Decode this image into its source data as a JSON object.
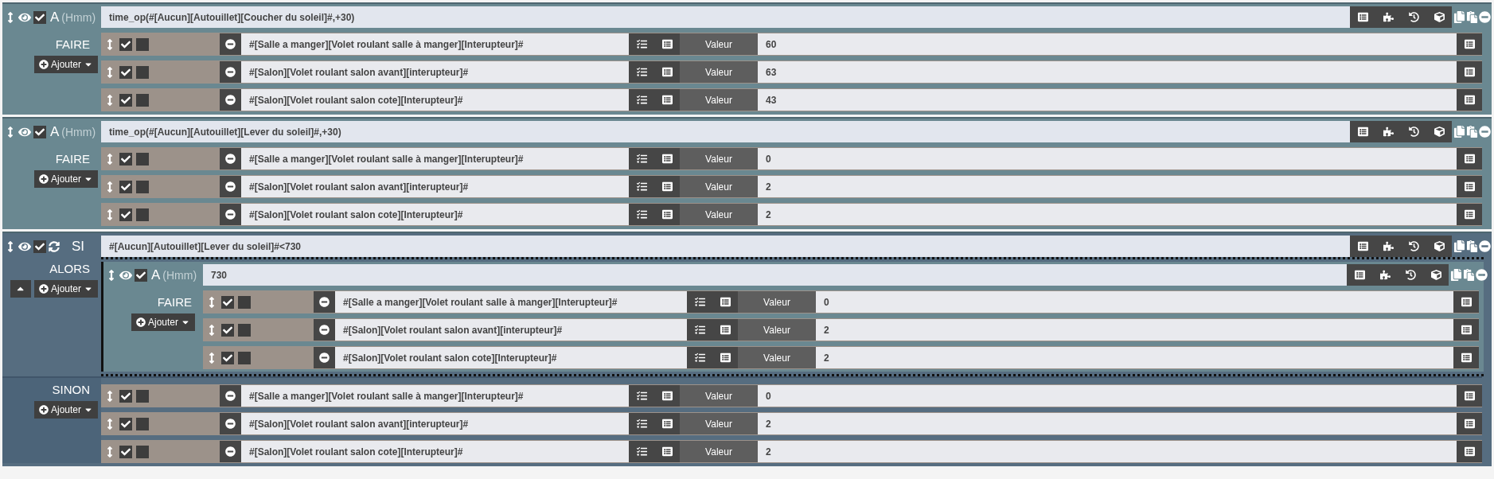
{
  "blocks": [
    {
      "kind": "action",
      "label": "A",
      "unit": "(Hmm)",
      "enabled": true,
      "expression": "time_op(#[Aucun][Autouillet][Coucher du soleil]#,+30)",
      "section_label": "FAIRE",
      "add_button": "Ajouter",
      "actions": [
        {
          "enabled": true,
          "option_checked": false,
          "command": "#[Salle a manger][Volet roulant salle à manger][Interupteur]#",
          "option_label": "Valeur",
          "value": "60"
        },
        {
          "enabled": true,
          "option_checked": false,
          "command": "#[Salon][Volet roulant salon avant][interupteur]#",
          "option_label": "Valeur",
          "value": "63"
        },
        {
          "enabled": true,
          "option_checked": false,
          "command": "#[Salon][Volet roulant salon cote][Interupteur]#",
          "option_label": "Valeur",
          "value": "43"
        }
      ]
    },
    {
      "kind": "action",
      "label": "A",
      "unit": "(Hmm)",
      "enabled": true,
      "expression": "time_op(#[Aucun][Autouillet][Lever du soleil]#,+30)",
      "section_label": "FAIRE",
      "add_button": "Ajouter",
      "actions": [
        {
          "enabled": true,
          "option_checked": false,
          "command": "#[Salle a manger][Volet roulant salle à manger][Interupteur]#",
          "option_label": "Valeur",
          "value": "0"
        },
        {
          "enabled": true,
          "option_checked": false,
          "command": "#[Salon][Volet roulant salon avant][interupteur]#",
          "option_label": "Valeur",
          "value": "2"
        },
        {
          "enabled": true,
          "option_checked": false,
          "command": "#[Salon][Volet roulant salon cote][Interupteur]#",
          "option_label": "Valeur",
          "value": "2"
        }
      ]
    },
    {
      "kind": "if",
      "label": "SI",
      "enabled": true,
      "expression": "#[Aucun][Autouillet][Lever du soleil]#<730",
      "then_label": "ALORS",
      "then_add": "Ajouter",
      "then": [
        {
          "kind": "action",
          "label": "A",
          "unit": "(Hmm)",
          "enabled": true,
          "expression": "730",
          "section_label": "FAIRE",
          "add_button": "Ajouter",
          "actions": [
            {
              "enabled": true,
              "option_checked": false,
              "command": "#[Salle a manger][Volet roulant salle à manger][Interupteur]#",
              "option_label": "Valeur",
              "value": "0"
            },
            {
              "enabled": true,
              "option_checked": false,
              "command": "#[Salon][Volet roulant salon avant][interupteur]#",
              "option_label": "Valeur",
              "value": "2"
            },
            {
              "enabled": true,
              "option_checked": false,
              "command": "#[Salon][Volet roulant salon cote][Interupteur]#",
              "option_label": "Valeur",
              "value": "2"
            }
          ]
        }
      ],
      "else_label": "SINON",
      "else_add": "Ajouter",
      "else": [
        {
          "enabled": true,
          "option_checked": false,
          "command": "#[Salle a manger][Volet roulant salle à manger][Interupteur]#",
          "option_label": "Valeur",
          "value": "0"
        },
        {
          "enabled": true,
          "option_checked": false,
          "command": "#[Salon][Volet roulant salon avant][interupteur]#",
          "option_label": "Valeur",
          "value": "2"
        },
        {
          "enabled": true,
          "option_checked": false,
          "command": "#[Salon][Volet roulant salon cote][Interupteur]#",
          "option_label": "Valeur",
          "value": "2"
        }
      ]
    }
  ]
}
